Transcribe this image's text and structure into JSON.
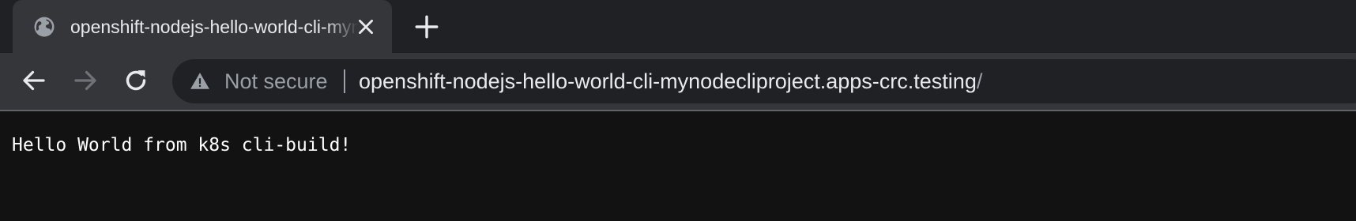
{
  "tab": {
    "title": "openshift-nodejs-hello-world-cli-mynodecliproject.apps-crc.testing/",
    "favicon": "globe-icon",
    "close_icon": "close-icon"
  },
  "new_tab_icon": "plus-icon",
  "toolbar": {
    "back_icon": "back-arrow-icon",
    "forward_icon": "forward-arrow-icon",
    "forward_enabled": false,
    "reload_icon": "reload-icon"
  },
  "omnibox": {
    "security_icon": "warning-triangle-icon",
    "security_label": "Not secure",
    "url_host": "openshift-nodejs-hello-world-cli-mynodecliproject.apps-crc.testing",
    "url_path": "/"
  },
  "page": {
    "body_text": "Hello World from k8s cli-build!"
  },
  "colors": {
    "tabstrip_bg": "#202124",
    "active_tab_bg": "#35363a",
    "omnibox_bg": "#202124",
    "page_bg": "#121212",
    "text_primary": "#e8eaed",
    "text_secondary": "#9aa0a6"
  }
}
